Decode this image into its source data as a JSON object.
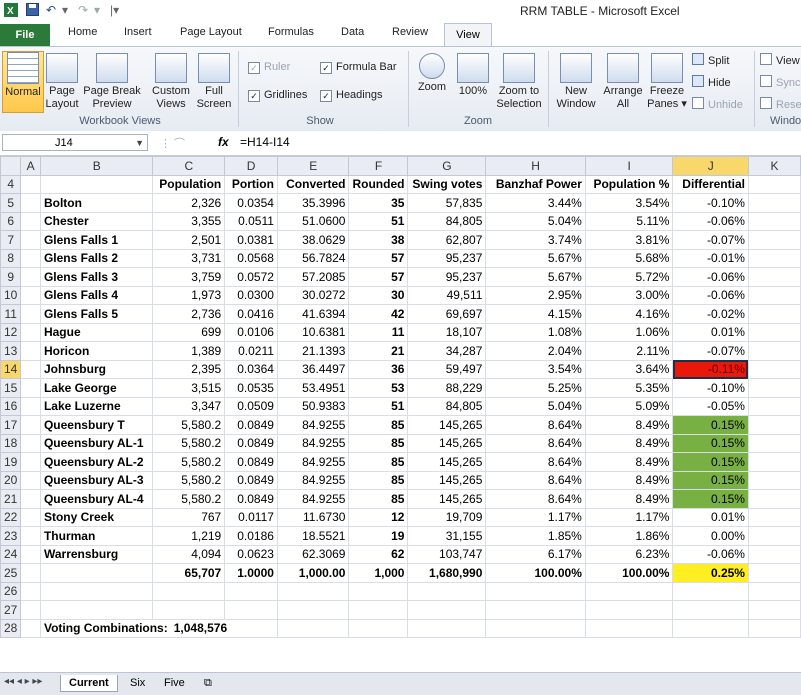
{
  "window": {
    "title": "RRM TABLE  -  Microsoft Excel"
  },
  "tabs": [
    "File",
    "Home",
    "Insert",
    "Page Layout",
    "Formulas",
    "Data",
    "Review",
    "View"
  ],
  "ribbon": {
    "workbook_views": {
      "label": "Workbook Views",
      "normal": "Normal",
      "page_layout": [
        "Page",
        "Layout"
      ],
      "page_break": [
        "Page Break",
        "Preview"
      ],
      "custom_views": [
        "Custom",
        "Views"
      ],
      "full_screen": [
        "Full",
        "Screen"
      ]
    },
    "show": {
      "label": "Show",
      "ruler": "Ruler",
      "gridlines": "Gridlines",
      "formula_bar": "Formula Bar",
      "headings": "Headings"
    },
    "zoom": {
      "label": "Zoom",
      "zoom": "Zoom",
      "hundred": "100%",
      "zoom_sel": [
        "Zoom to",
        "Selection"
      ]
    },
    "window": {
      "label": "Windo",
      "new_window": [
        "New",
        "Window"
      ],
      "arrange_all": [
        "Arrange",
        "All"
      ],
      "freeze_panes": [
        "Freeze",
        "Panes ▾"
      ],
      "split": "Split",
      "hide": "Hide",
      "unhide": "Unhide",
      "view_side": "View",
      "sync": "Sync",
      "reset": "Rese"
    }
  },
  "formula_bar": {
    "name_box": "J14",
    "fx": "fx",
    "formula": "=H14-I14"
  },
  "columns": [
    "A",
    "B",
    "C",
    "D",
    "E",
    "F",
    "G",
    "H",
    "I",
    "J",
    "K"
  ],
  "headers": {
    "row": "4",
    "cells": [
      "",
      "",
      "Population",
      "Portion",
      "Converted",
      "Rounded",
      "Swing votes",
      "Banzhaf Power",
      "Population %",
      "Differential",
      ""
    ]
  },
  "rows": [
    {
      "num": "5",
      "name": "Bolton",
      "pop": "2,326",
      "portion": "0.0354",
      "conv": "35.3996",
      "round": "35",
      "swing": "57,835",
      "banzhaf": "3.44%",
      "popct": "3.54%",
      "diff": "-0.10%"
    },
    {
      "num": "6",
      "name": "Chester",
      "pop": "3,355",
      "portion": "0.0511",
      "conv": "51.0600",
      "round": "51",
      "swing": "84,805",
      "banzhaf": "5.04%",
      "popct": "5.11%",
      "diff": "-0.06%"
    },
    {
      "num": "7",
      "name": "Glens Falls 1",
      "pop": "2,501",
      "portion": "0.0381",
      "conv": "38.0629",
      "round": "38",
      "swing": "62,807",
      "banzhaf": "3.74%",
      "popct": "3.81%",
      "diff": "-0.07%"
    },
    {
      "num": "8",
      "name": "Glens Falls 2",
      "pop": "3,731",
      "portion": "0.0568",
      "conv": "56.7824",
      "round": "57",
      "swing": "95,237",
      "banzhaf": "5.67%",
      "popct": "5.68%",
      "diff": "-0.01%"
    },
    {
      "num": "9",
      "name": "Glens Falls 3",
      "pop": "3,759",
      "portion": "0.0572",
      "conv": "57.2085",
      "round": "57",
      "swing": "95,237",
      "banzhaf": "5.67%",
      "popct": "5.72%",
      "diff": "-0.06%"
    },
    {
      "num": "10",
      "name": "Glens Falls 4",
      "pop": "1,973",
      "portion": "0.0300",
      "conv": "30.0272",
      "round": "30",
      "swing": "49,511",
      "banzhaf": "2.95%",
      "popct": "3.00%",
      "diff": "-0.06%"
    },
    {
      "num": "11",
      "name": "Glens Falls 5",
      "pop": "2,736",
      "portion": "0.0416",
      "conv": "41.6394",
      "round": "42",
      "swing": "69,697",
      "banzhaf": "4.15%",
      "popct": "4.16%",
      "diff": "-0.02%"
    },
    {
      "num": "12",
      "name": "Hague",
      "pop": "699",
      "portion": "0.0106",
      "conv": "10.6381",
      "round": "11",
      "swing": "18,107",
      "banzhaf": "1.08%",
      "popct": "1.06%",
      "diff": "0.01%"
    },
    {
      "num": "13",
      "name": "Horicon",
      "pop": "1,389",
      "portion": "0.0211",
      "conv": "21.1393",
      "round": "21",
      "swing": "34,287",
      "banzhaf": "2.04%",
      "popct": "2.11%",
      "diff": "-0.07%"
    },
    {
      "num": "14",
      "name": "Johnsburg",
      "pop": "2,395",
      "portion": "0.0364",
      "conv": "36.4497",
      "round": "36",
      "swing": "59,497",
      "banzhaf": "3.54%",
      "popct": "3.64%",
      "diff": "-0.11%"
    },
    {
      "num": "15",
      "name": "Lake George",
      "pop": "3,515",
      "portion": "0.0535",
      "conv": "53.4951",
      "round": "53",
      "swing": "88,229",
      "banzhaf": "5.25%",
      "popct": "5.35%",
      "diff": "-0.10%"
    },
    {
      "num": "16",
      "name": "Lake Luzerne",
      "pop": "3,347",
      "portion": "0.0509",
      "conv": "50.9383",
      "round": "51",
      "swing": "84,805",
      "banzhaf": "5.04%",
      "popct": "5.09%",
      "diff": "-0.05%"
    },
    {
      "num": "17",
      "name": "Queensbury T",
      "pop": "5,580.2",
      "portion": "0.0849",
      "conv": "84.9255",
      "round": "85",
      "swing": "145,265",
      "banzhaf": "8.64%",
      "popct": "8.49%",
      "diff": "0.15%"
    },
    {
      "num": "18",
      "name": "Queensbury AL-1",
      "pop": "5,580.2",
      "portion": "0.0849",
      "conv": "84.9255",
      "round": "85",
      "swing": "145,265",
      "banzhaf": "8.64%",
      "popct": "8.49%",
      "diff": "0.15%"
    },
    {
      "num": "19",
      "name": "Queensbury AL-2",
      "pop": "5,580.2",
      "portion": "0.0849",
      "conv": "84.9255",
      "round": "85",
      "swing": "145,265",
      "banzhaf": "8.64%",
      "popct": "8.49%",
      "diff": "0.15%"
    },
    {
      "num": "20",
      "name": "Queensbury AL-3",
      "pop": "5,580.2",
      "portion": "0.0849",
      "conv": "84.9255",
      "round": "85",
      "swing": "145,265",
      "banzhaf": "8.64%",
      "popct": "8.49%",
      "diff": "0.15%"
    },
    {
      "num": "21",
      "name": "Queensbury AL-4",
      "pop": "5,580.2",
      "portion": "0.0849",
      "conv": "84.9255",
      "round": "85",
      "swing": "145,265",
      "banzhaf": "8.64%",
      "popct": "8.49%",
      "diff": "0.15%"
    },
    {
      "num": "22",
      "name": "Stony Creek",
      "pop": "767",
      "portion": "0.0117",
      "conv": "11.6730",
      "round": "12",
      "swing": "19,709",
      "banzhaf": "1.17%",
      "popct": "1.17%",
      "diff": "0.01%"
    },
    {
      "num": "23",
      "name": "Thurman",
      "pop": "1,219",
      "portion": "0.0186",
      "conv": "18.5521",
      "round": "19",
      "swing": "31,155",
      "banzhaf": "1.85%",
      "popct": "1.86%",
      "diff": "0.00%"
    },
    {
      "num": "24",
      "name": "Warrensburg",
      "pop": "4,094",
      "portion": "0.0623",
      "conv": "62.3069",
      "round": "62",
      "swing": "103,747",
      "banzhaf": "6.17%",
      "popct": "6.23%",
      "diff": "-0.06%"
    }
  ],
  "totals": {
    "num": "25",
    "pop": "65,707",
    "portion": "1.0000",
    "conv": "1,000.00",
    "round": "1,000",
    "swing": "1,680,990",
    "banzhaf": "100.00%",
    "popct": "100.00%",
    "diff": "0.25%"
  },
  "blank_rows": [
    "26",
    "27"
  ],
  "voting": {
    "num": "28",
    "label": "Voting Combinations:",
    "value": "1,048,576"
  },
  "sheets": [
    "Current",
    "Six",
    "Five"
  ],
  "colors": {
    "red": "#e8180a",
    "green": "#78b043",
    "yellow": "#ffee22",
    "file_tab": "#2c7a3a"
  }
}
